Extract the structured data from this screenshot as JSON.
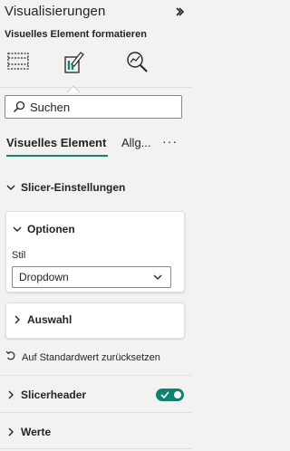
{
  "pane": {
    "title": "Visualisierungen",
    "subtitle": "Visuelles Element formatieren"
  },
  "icons": {
    "build": "build-visual-icon",
    "format": "format-paintbrush-icon",
    "analytics": "analytics-magnifier-icon"
  },
  "search": {
    "placeholder": "Suchen"
  },
  "tabs": [
    {
      "label": "Visuelles Element",
      "active": true
    },
    {
      "label": "Allg...",
      "active": false
    }
  ],
  "more_label": "···",
  "sections": {
    "slicer_settings": "Slicer-Einstellungen",
    "options": {
      "label": "Optionen",
      "style_label": "Stil",
      "style_value": "Dropdown"
    },
    "selection": "Auswahl",
    "reset": "Auf Standardwert zurücksetzen",
    "slicer_header": {
      "label": "Slicerheader",
      "enabled": true
    },
    "values": "Werte"
  },
  "colors": {
    "accent": "#118272",
    "pane_bg": "#f3f2f1"
  }
}
